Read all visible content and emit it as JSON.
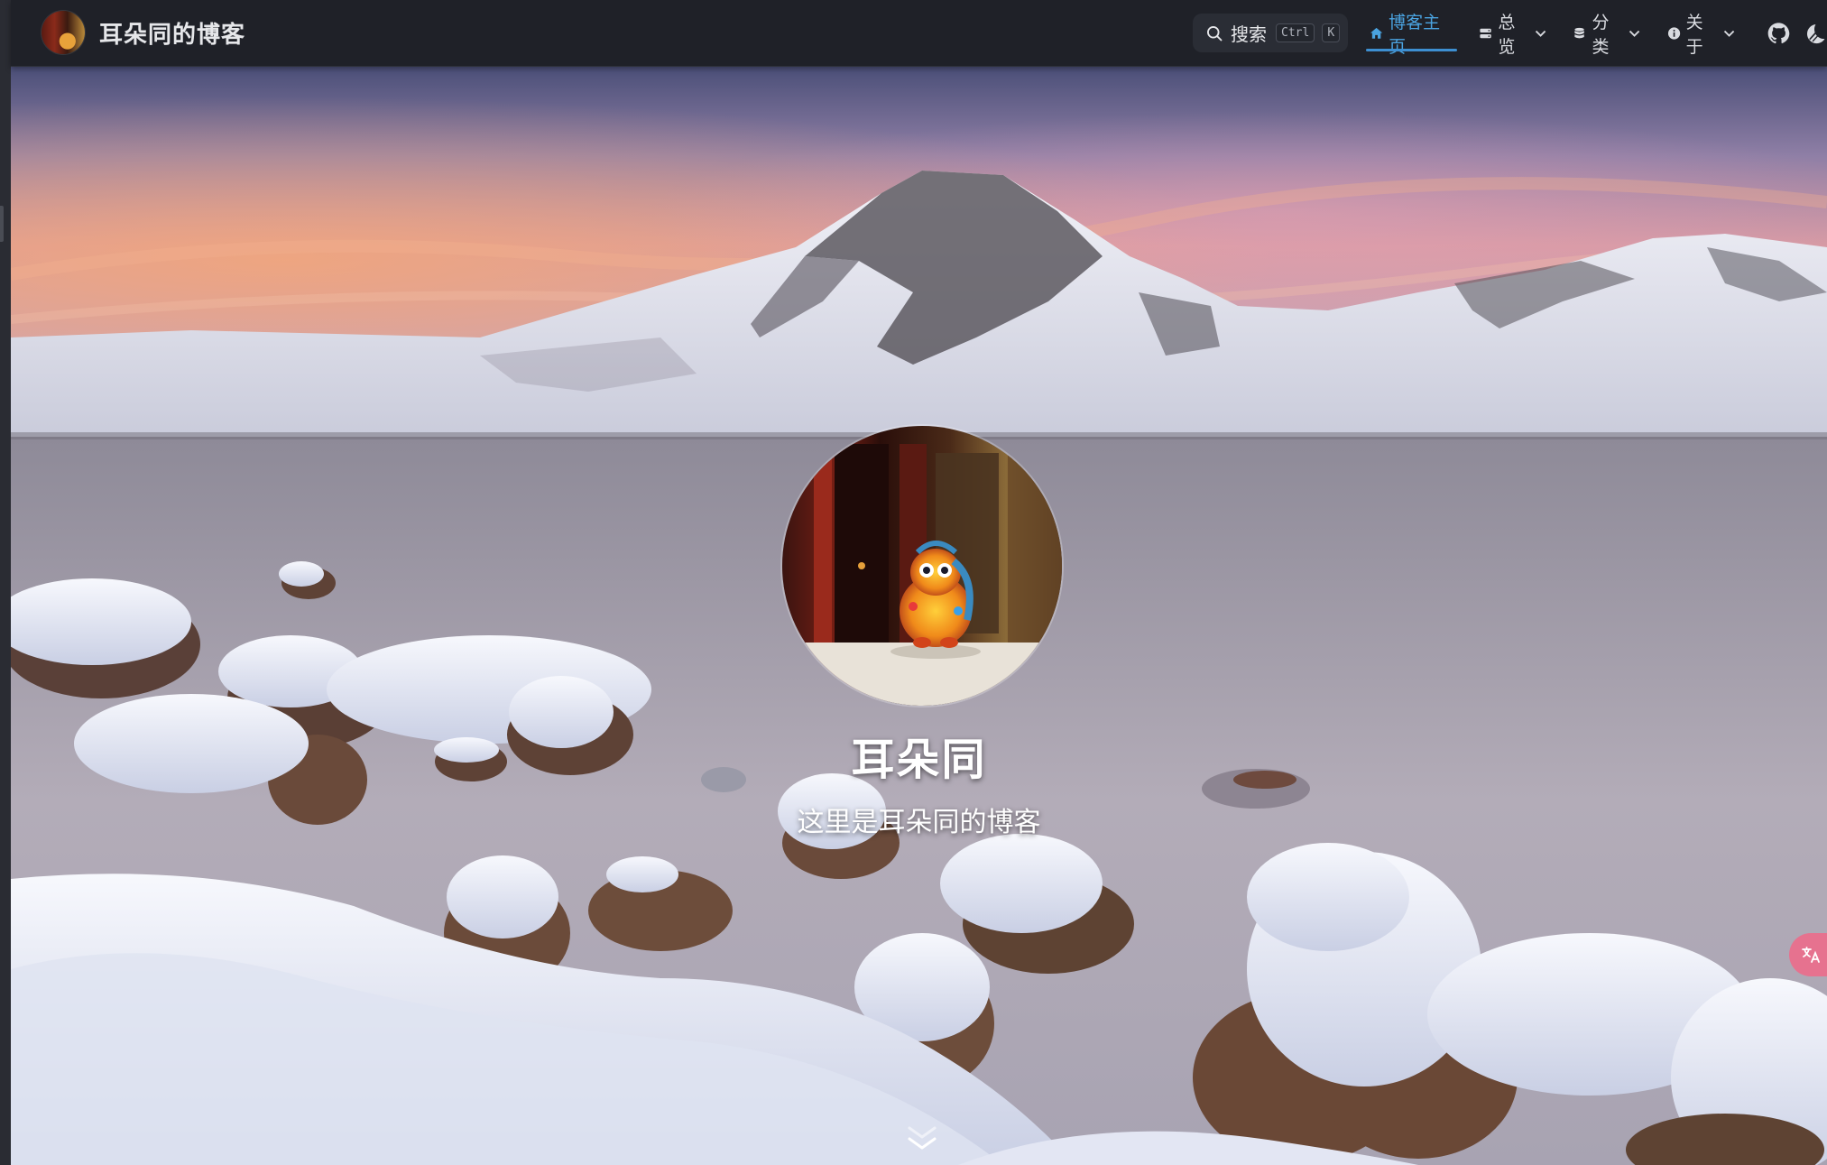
{
  "site": {
    "title": "耳朵同的博客"
  },
  "search": {
    "label": "搜索",
    "key1": "Ctrl",
    "key2": "K"
  },
  "nav": {
    "items": [
      {
        "label": "博客主页",
        "icon": "home-icon",
        "active": true
      },
      {
        "label": "总览",
        "icon": "server-icon",
        "active": false
      },
      {
        "label": "分类",
        "icon": "database-icon",
        "active": false
      },
      {
        "label": "关于",
        "icon": "info-icon",
        "active": false
      }
    ],
    "github_icon": "github-icon",
    "theme_icon": "moon-icon"
  },
  "hero": {
    "name": "耳朵同",
    "description": "这里是耳朵同的博客",
    "scroll_icon": "chevron-double-down-icon"
  },
  "floating": {
    "translate_icon": "translate-icon"
  },
  "colors": {
    "navbar_bg": "#1f2128",
    "accent": "#3d8fd1",
    "fab": "#e6728f"
  }
}
